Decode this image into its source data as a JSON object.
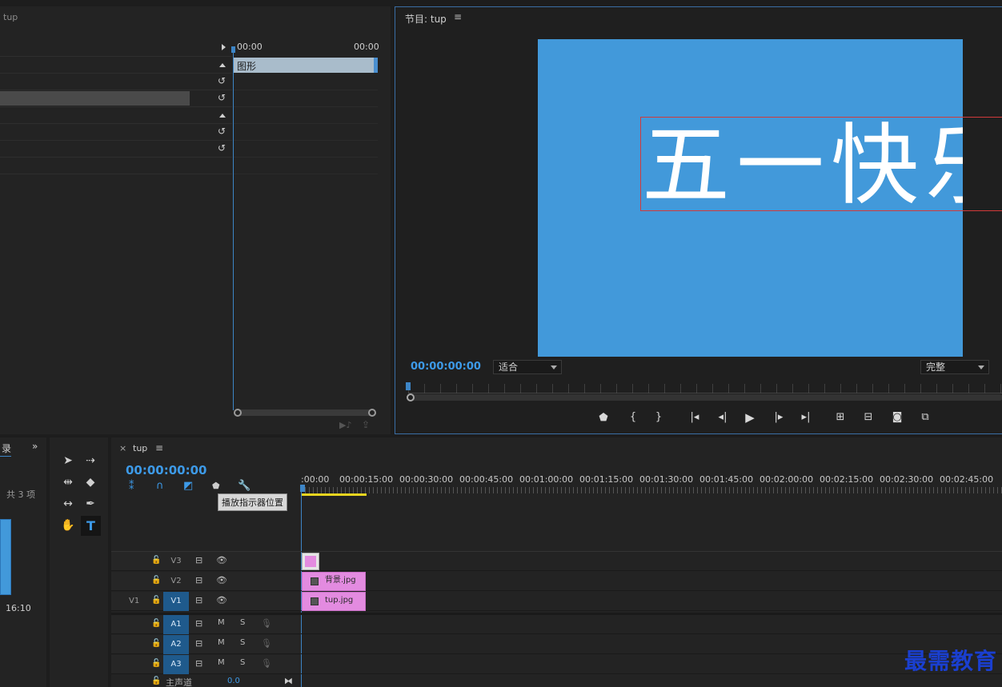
{
  "effect_controls": {
    "title_fragment": "tup",
    "timecode_start": "00:00",
    "timecode_end": "00:00",
    "clip_label": "图形"
  },
  "program_monitor": {
    "title": "节目: tup",
    "menu_icon": "hamburger-icon",
    "video_text": "五一快乐",
    "timecode": "00:00:00:00",
    "zoom_select": "适合",
    "quality_select": "完整"
  },
  "project_panel": {
    "tab_fragment": "录",
    "count": "共 3 项",
    "thumb_time": "16:10"
  },
  "timeline": {
    "sequence_name": "tup",
    "timecode": "00:00:00:00",
    "tooltip": "播放指示器位置",
    "ruler": [
      ":00:00",
      "00:00:15:00",
      "00:00:30:00",
      "00:00:45:00",
      "00:01:00:00",
      "00:01:15:00",
      "00:01:30:00",
      "00:01:45:00",
      "00:02:00:00",
      "00:02:15:00",
      "00:02:30:00",
      "00:02:45:00"
    ],
    "video_tracks": [
      {
        "name": "V3",
        "source": ""
      },
      {
        "name": "V2",
        "source": ""
      },
      {
        "name": "V1",
        "source": "V1"
      }
    ],
    "audio_tracks": [
      {
        "name": "A1",
        "m": "M",
        "s": "S"
      },
      {
        "name": "A2",
        "m": "M",
        "s": "S"
      },
      {
        "name": "A3",
        "m": "M",
        "s": "S"
      }
    ],
    "master": {
      "label": "主声道",
      "value": "0.0"
    },
    "clips": {
      "v2": "背景.jpg",
      "v1": "tup.jpg"
    }
  },
  "watermark": "最需教育",
  "colors": {
    "accent_blue": "#4299da",
    "clip_pink": "#e38be0",
    "track_on": "#1f5a8c",
    "text_box_red": "#d23a3a"
  }
}
